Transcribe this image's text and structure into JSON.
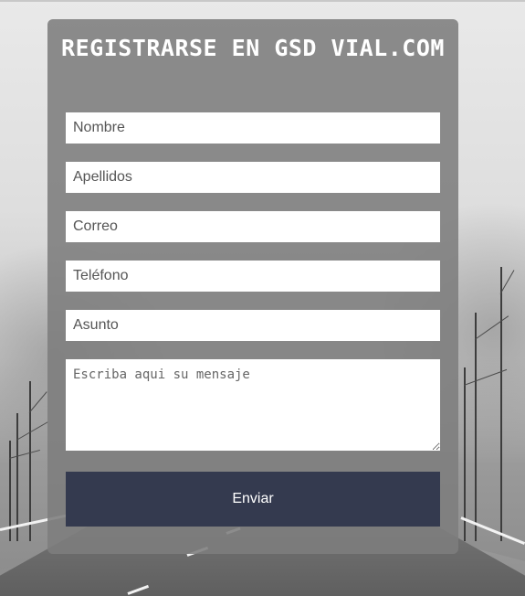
{
  "form": {
    "title": "REGISTRARSE EN GSD VIAL.COM",
    "fields": {
      "nombre": {
        "value": "",
        "placeholder": "Nombre"
      },
      "apellidos": {
        "value": "",
        "placeholder": "Apellidos"
      },
      "correo": {
        "value": "",
        "placeholder": "Correo"
      },
      "telefono": {
        "value": "",
        "placeholder": "Teléfono"
      },
      "asunto": {
        "value": "",
        "placeholder": "Asunto"
      },
      "mensaje": {
        "value": "",
        "placeholder": "Escriba aqui su mensaje"
      }
    },
    "submit_label": "Enviar"
  },
  "colors": {
    "panel_bg": "#7d7d7d",
    "button_bg": "#343a4f",
    "title_text": "#ffffff"
  },
  "background": {
    "description_icon": "foggy-road-background"
  }
}
